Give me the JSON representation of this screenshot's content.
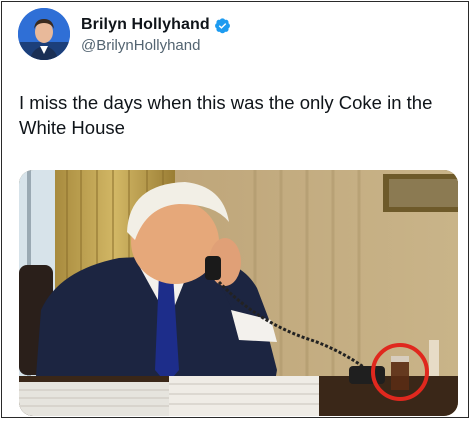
{
  "tweet": {
    "author": {
      "display_name": "Brilyn Hollyhand",
      "handle": "@BrilynHollyhand",
      "verified": true,
      "verified_icon": "verified-badge-icon",
      "verified_color": "#1d9bf0"
    },
    "text": "I miss the days when this was the only Coke in the White House",
    "media": {
      "type": "photo",
      "highlight_color": "#e0281e"
    }
  }
}
